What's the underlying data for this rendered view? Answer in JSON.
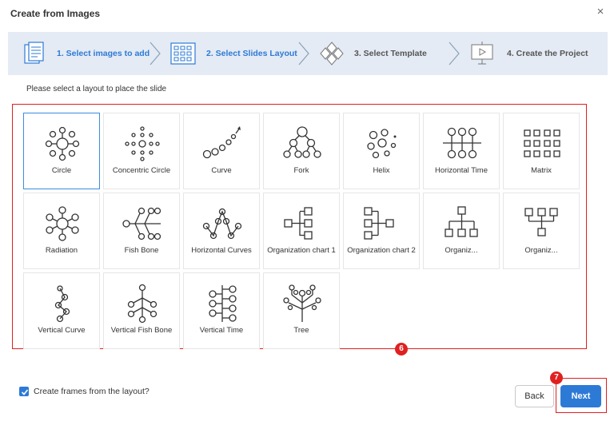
{
  "window": {
    "title": "Create from Images",
    "close_glyph": "×"
  },
  "steps": [
    {
      "label": "1. Select images to add",
      "state": "active",
      "icon": "document-icon"
    },
    {
      "label": "2. Select Slides Layout",
      "state": "active",
      "icon": "layout-grid-icon"
    },
    {
      "label": "3. Select Template",
      "state": "inactive",
      "icon": "template-diamond-icon"
    },
    {
      "label": "4. Create the Project",
      "state": "inactive",
      "icon": "presentation-board-icon"
    }
  ],
  "instruction": "Please select a layout to place the slide",
  "layouts": [
    {
      "label": "Circle",
      "icon": "circle-layout-icon",
      "selected": true
    },
    {
      "label": "Concentric Circle",
      "icon": "concentric-circle-layout-icon"
    },
    {
      "label": "Curve",
      "icon": "curve-layout-icon"
    },
    {
      "label": "Fork",
      "icon": "fork-layout-icon"
    },
    {
      "label": "Helix",
      "icon": "helix-layout-icon"
    },
    {
      "label": "Horizontal Time",
      "icon": "horizontal-time-layout-icon"
    },
    {
      "label": "Matrix",
      "icon": "matrix-layout-icon"
    },
    {
      "label": "Radiation",
      "icon": "radiation-layout-icon"
    },
    {
      "label": "Fish Bone",
      "icon": "fish-bone-layout-icon"
    },
    {
      "label": "Horizontal Curves",
      "icon": "horizontal-curves-layout-icon"
    },
    {
      "label": "Organization chart 1",
      "icon": "org-chart-1-layout-icon"
    },
    {
      "label": "Organization chart 2",
      "icon": "org-chart-2-layout-icon"
    },
    {
      "label": "Organiz...",
      "icon": "org-chart-3-layout-icon"
    },
    {
      "label": "Organiz...",
      "icon": "org-chart-4-layout-icon"
    },
    {
      "label": "Vertical Curve",
      "icon": "vertical-curve-layout-icon"
    },
    {
      "label": "Vertical Fish Bone",
      "icon": "vertical-fish-bone-layout-icon"
    },
    {
      "label": "Vertical Time",
      "icon": "vertical-time-layout-icon"
    },
    {
      "label": "Tree",
      "icon": "tree-layout-icon"
    }
  ],
  "markers": {
    "grid": "6",
    "next": "7"
  },
  "footer": {
    "checkbox_label": "Create frames from the layout?",
    "checkbox_checked": true,
    "back_label": "Back",
    "next_label": "Next"
  },
  "colors": {
    "accent": "#2d7ad6",
    "highlight": "#e02020",
    "step_bar": "#e4ebf4"
  }
}
